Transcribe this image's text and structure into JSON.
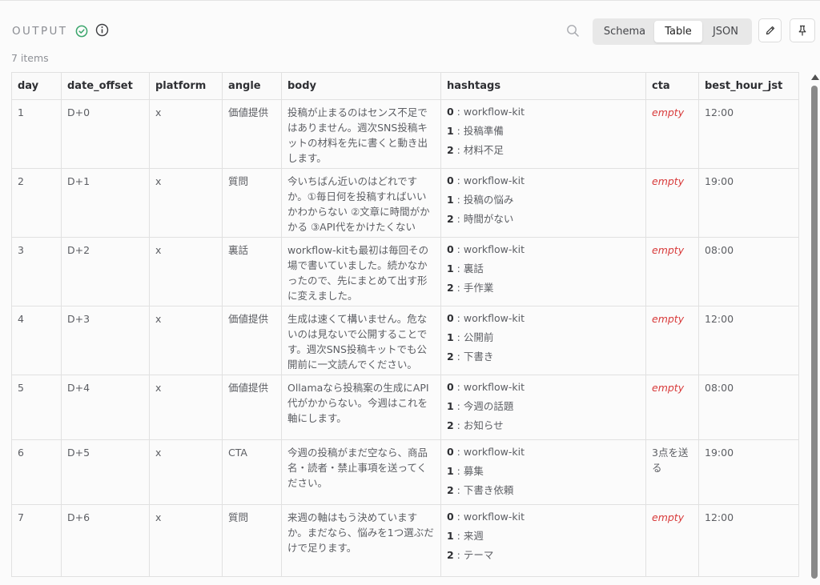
{
  "header": {
    "title": "OUTPUT",
    "view_tabs": [
      "Schema",
      "Table",
      "JSON"
    ],
    "active_tab": "Table"
  },
  "items_count": "7 items",
  "table": {
    "columns": [
      "day",
      "date_offset",
      "platform",
      "angle",
      "body",
      "hashtags",
      "cta",
      "best_hour_jst"
    ],
    "rows": [
      {
        "day": "1",
        "date_offset": "D+0",
        "platform": "x",
        "angle": "価値提供",
        "body": "投稿が止まるのはセンス不足ではありません。週次SNS投稿キットの材料を先に書くと動き出します。",
        "hashtags": [
          {
            "k": "0",
            "v": "workflow-kit"
          },
          {
            "k": "1",
            "v": "投稿準備"
          },
          {
            "k": "2",
            "v": "材料不足"
          }
        ],
        "cta": "empty",
        "cta_empty": true,
        "best_hour_jst": "12:00"
      },
      {
        "day": "2",
        "date_offset": "D+1",
        "platform": "x",
        "angle": "質問",
        "body": "今いちばん近いのはどれですか。①毎日何を投稿すればいいかわからない ②文章に時間がかかる ③API代をかけたくない",
        "hashtags": [
          {
            "k": "0",
            "v": "workflow-kit"
          },
          {
            "k": "1",
            "v": "投稿の悩み"
          },
          {
            "k": "2",
            "v": "時間がない"
          }
        ],
        "cta": "empty",
        "cta_empty": true,
        "best_hour_jst": "19:00"
      },
      {
        "day": "3",
        "date_offset": "D+2",
        "platform": "x",
        "angle": "裏話",
        "body": "workflow-kitも最初は毎回その場で書いていました。続かなかったので、先にまとめて出す形に変えました。",
        "hashtags": [
          {
            "k": "0",
            "v": "workflow-kit"
          },
          {
            "k": "1",
            "v": "裏話"
          },
          {
            "k": "2",
            "v": "手作業"
          }
        ],
        "cta": "empty",
        "cta_empty": true,
        "best_hour_jst": "08:00"
      },
      {
        "day": "4",
        "date_offset": "D+3",
        "platform": "x",
        "angle": "価値提供",
        "body": "生成は速くて構いません。危ないのは見ないで公開することです。週次SNS投稿キットでも公開前に一文読んでください。",
        "hashtags": [
          {
            "k": "0",
            "v": "workflow-kit"
          },
          {
            "k": "1",
            "v": "公開前"
          },
          {
            "k": "2",
            "v": "下書き"
          }
        ],
        "cta": "empty",
        "cta_empty": true,
        "best_hour_jst": "12:00"
      },
      {
        "day": "5",
        "date_offset": "D+4",
        "platform": "x",
        "angle": "価値提供",
        "body": "Ollamaなら投稿案の生成にAPI代がかからない。今週はこれを軸にします。",
        "hashtags": [
          {
            "k": "0",
            "v": "workflow-kit"
          },
          {
            "k": "1",
            "v": "今週の話題"
          },
          {
            "k": "2",
            "v": "お知らせ"
          }
        ],
        "cta": "empty",
        "cta_empty": true,
        "best_hour_jst": "08:00"
      },
      {
        "day": "6",
        "date_offset": "D+5",
        "platform": "x",
        "angle": "CTA",
        "body": "今週の投稿がまだ空なら、商品名・読者・禁止事項を送ってください。",
        "hashtags": [
          {
            "k": "0",
            "v": "workflow-kit"
          },
          {
            "k": "1",
            "v": "募集"
          },
          {
            "k": "2",
            "v": "下書き依頼"
          }
        ],
        "cta": "3点を送る",
        "cta_empty": false,
        "best_hour_jst": "19:00"
      },
      {
        "day": "7",
        "date_offset": "D+6",
        "platform": "x",
        "angle": "質問",
        "body": "来週の軸はもう決めていますか。まだなら、悩みを1つ選ぶだけで足ります。",
        "hashtags": [
          {
            "k": "0",
            "v": "workflow-kit"
          },
          {
            "k": "1",
            "v": "来週"
          },
          {
            "k": "2",
            "v": "テーマ"
          }
        ],
        "cta": "empty",
        "cta_empty": true,
        "best_hour_jst": "12:00"
      }
    ]
  },
  "colors": {
    "success": "#3aa56b",
    "empty_value": "#d83a3a"
  },
  "icons": [
    "check-circle-icon",
    "info-icon",
    "search-icon",
    "edit-pencil-icon",
    "pin-icon"
  ]
}
